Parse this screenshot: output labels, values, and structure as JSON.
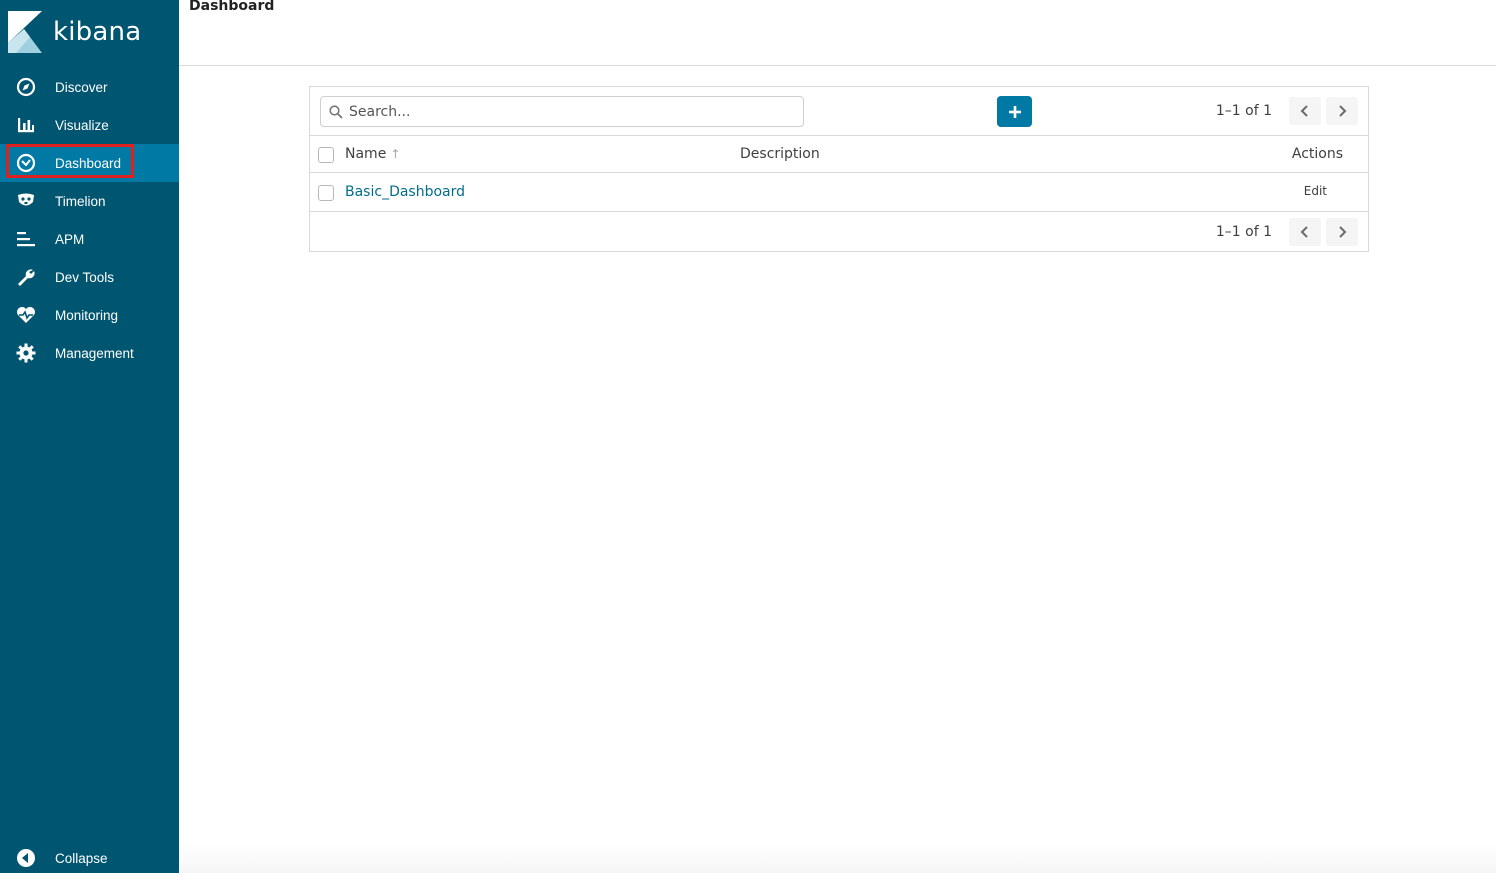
{
  "app": {
    "logo_text": "kibana",
    "page_title": "Dashboard"
  },
  "sidebar": {
    "items": [
      {
        "label": "Discover",
        "icon": "compass-icon"
      },
      {
        "label": "Visualize",
        "icon": "bar-chart-icon"
      },
      {
        "label": "Dashboard",
        "icon": "dashboard-gauge-icon",
        "active": true
      },
      {
        "label": "Timelion",
        "icon": "timelion-mask-icon"
      },
      {
        "label": "APM",
        "icon": "apm-lines-icon"
      },
      {
        "label": "Dev Tools",
        "icon": "wrench-icon"
      },
      {
        "label": "Monitoring",
        "icon": "heartbeat-icon"
      },
      {
        "label": "Management",
        "icon": "gear-icon"
      }
    ],
    "collapse_label": "Collapse"
  },
  "listing": {
    "search_placeholder": "Search...",
    "pager_text": "1–1 of 1",
    "columns": {
      "name": "Name",
      "description": "Description",
      "actions": "Actions"
    },
    "rows": [
      {
        "name": "Basic_Dashboard",
        "description": "",
        "action": "Edit"
      }
    ]
  },
  "colors": {
    "sidebar_bg": "#005571",
    "active_item_bg": "#0079a5",
    "accent": "#0079a5",
    "highlight_box": "#e0201e",
    "link": "#006e8a"
  }
}
